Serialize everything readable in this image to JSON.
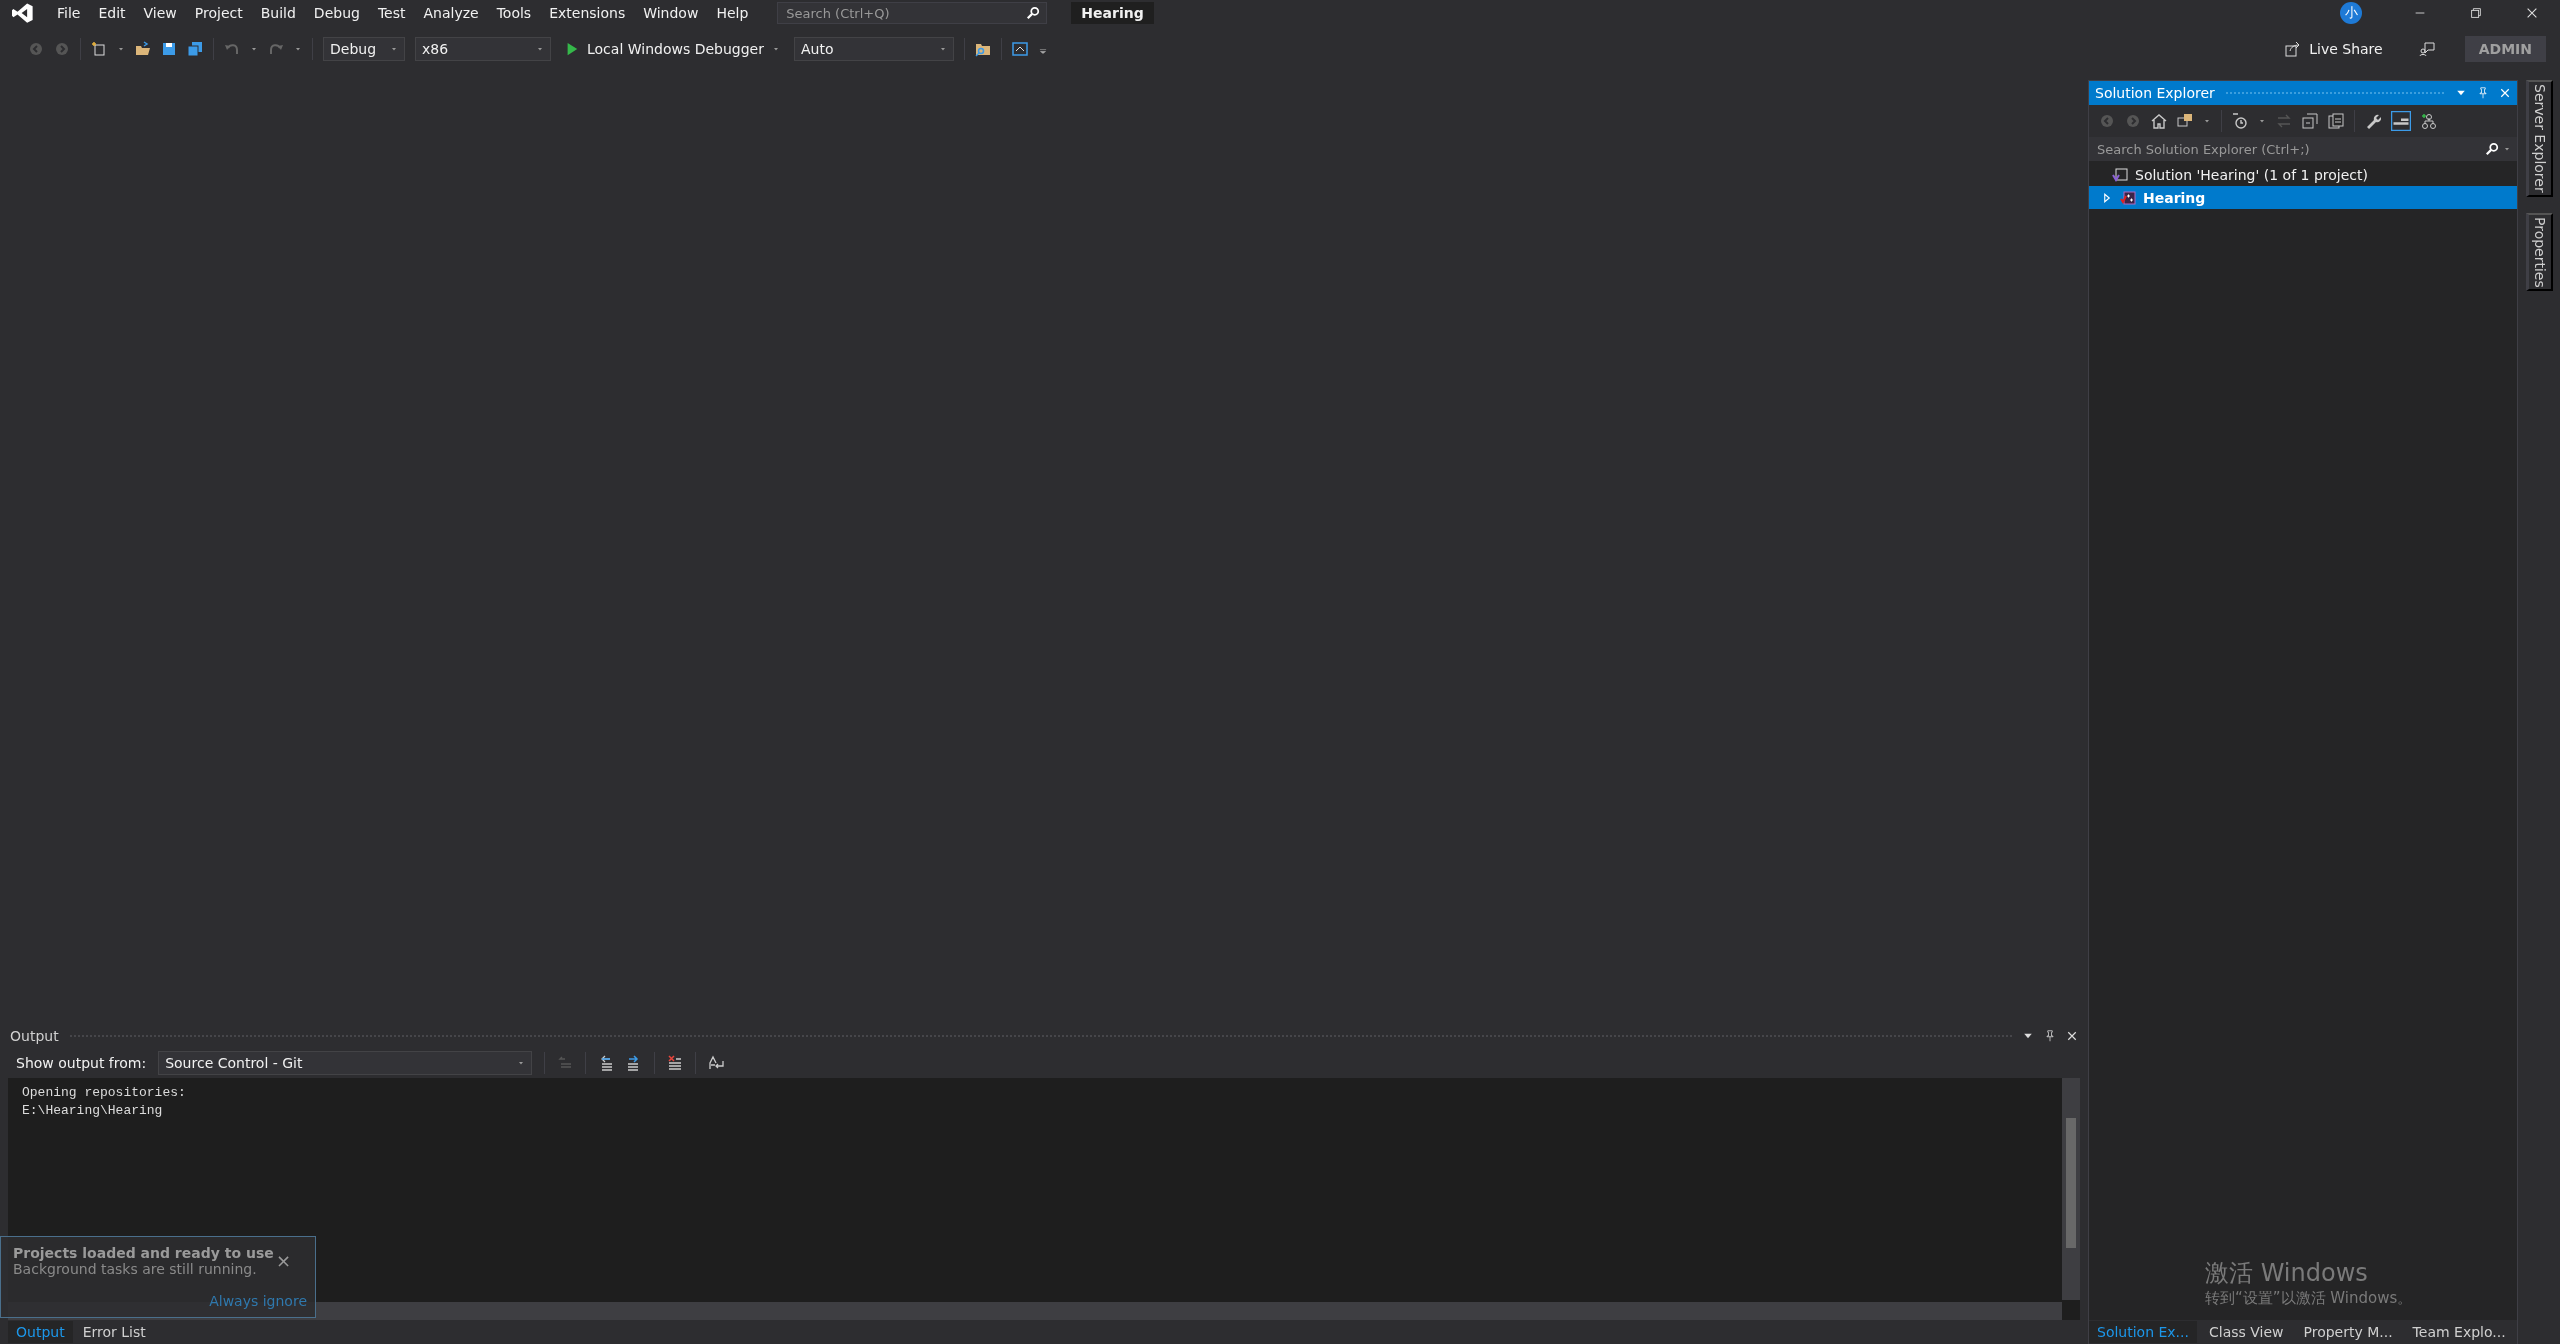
{
  "title_bar": {
    "menus": [
      "File",
      "Edit",
      "View",
      "Project",
      "Build",
      "Debug",
      "Test",
      "Analyze",
      "Tools",
      "Extensions",
      "Window",
      "Help"
    ],
    "search": {
      "placeholder": "Search (Ctrl+Q)"
    },
    "solution_name": "Hearing",
    "account_initial": "小"
  },
  "toolbar": {
    "configuration": "Debug",
    "platform": "x86",
    "debugger": "Local Windows Debugger",
    "target": "Auto",
    "live_share": "Live Share",
    "admin": "ADMIN"
  },
  "solution_explorer": {
    "title": "Solution Explorer",
    "search": {
      "placeholder": "Search Solution Explorer (Ctrl+;)"
    },
    "tree": [
      {
        "label": "Solution 'Hearing' (1 of 1 project)",
        "selected": false,
        "children": [
          {
            "label": "Hearing",
            "selected": true,
            "expanded": false
          }
        ]
      }
    ],
    "tabs": [
      {
        "label": "Solution Ex...",
        "selected": true
      },
      {
        "label": "Class View",
        "selected": false
      },
      {
        "label": "Property M...",
        "selected": false
      },
      {
        "label": "Team Explo...",
        "selected": false
      }
    ]
  },
  "side_tabs": [
    "Server Explorer",
    "Properties"
  ],
  "output": {
    "title": "Output",
    "source_label": "Show output from:",
    "source": "Source Control - Git",
    "lines": [
      "Opening repositories:",
      "E:\\Hearing\\Hearing"
    ],
    "tabs": [
      {
        "label": "Output",
        "selected": true
      },
      {
        "label": "Error List",
        "selected": false
      }
    ]
  },
  "notification": {
    "title": "Projects loaded and ready to use",
    "message": "Background tasks are still running.",
    "action": "Always ignore",
    "close": "×"
  },
  "activation": {
    "title": "激活 Windows",
    "message": "转到“设置”以激活 Windows。"
  }
}
